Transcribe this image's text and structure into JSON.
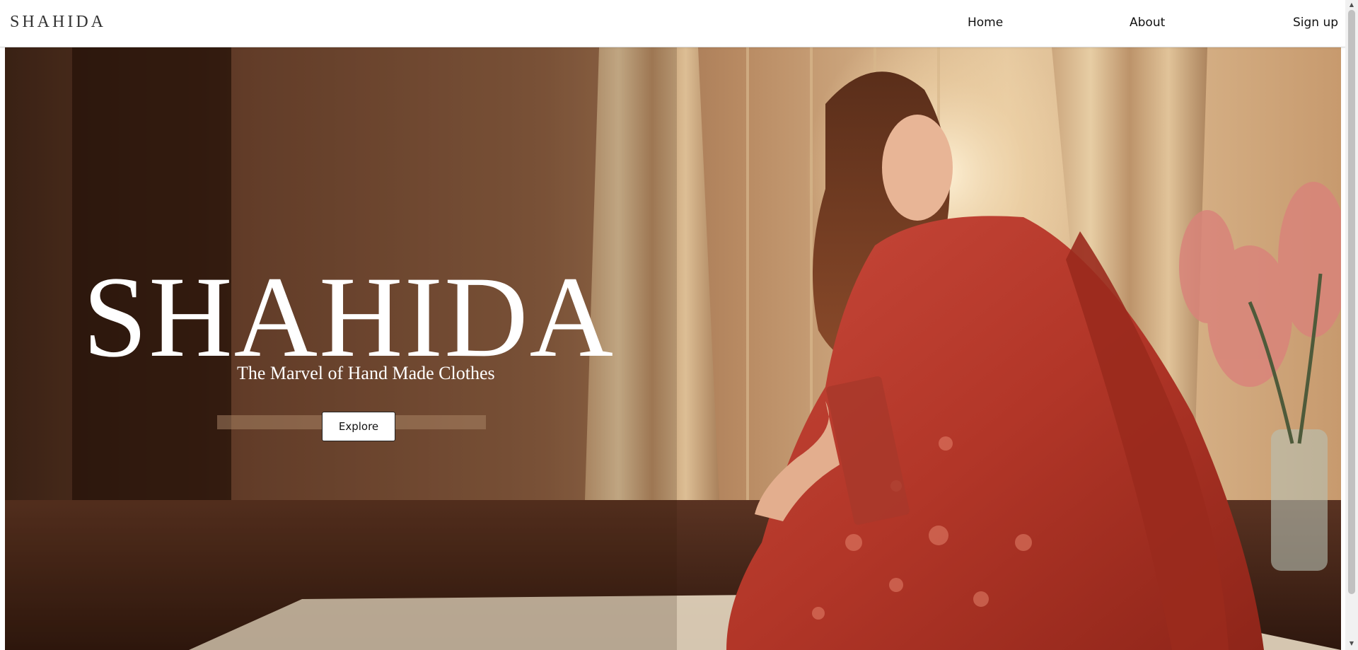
{
  "nav": {
    "brand": "SHAHIDA",
    "links": [
      {
        "label": "Home"
      },
      {
        "label": "About"
      },
      {
        "label": "Sign up"
      }
    ]
  },
  "hero": {
    "title": "SHAHIDA",
    "subtitle": "The Marvel of Hand Made Clothes",
    "cta_label": "Explore",
    "background_image": "woman-in-red-embroidered-dress-photo"
  },
  "scrollbar": {
    "up_icon": "scroll-up-arrow-icon",
    "down_icon": "scroll-down-arrow-icon"
  },
  "colors": {
    "text_on_hero": "#ffffff",
    "nav_bg": "#ffffff",
    "dress_red": "#b53a2c",
    "room_brown": "#7a4e35"
  }
}
